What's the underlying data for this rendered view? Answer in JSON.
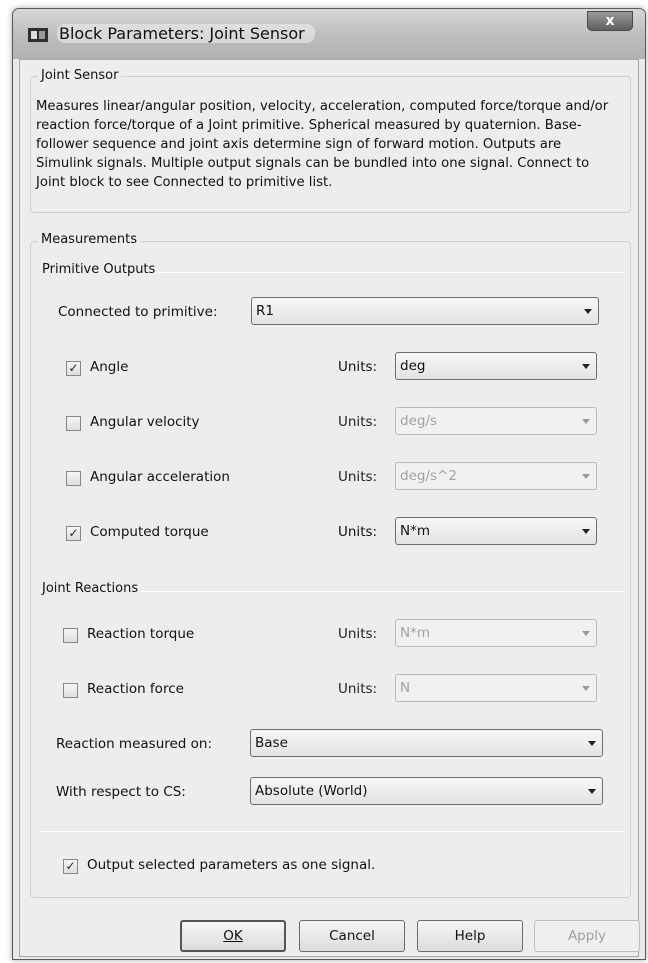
{
  "window": {
    "title": "Block Parameters: Joint Sensor",
    "close_label": "x"
  },
  "header_group": {
    "label": "Joint Sensor",
    "description": "Measures linear/angular position, velocity, acceleration, computed force/torque and/or reaction force/torque of a Joint primitive. Spherical measured by quaternion. Base-follower sequence and joint axis determine sign of forward motion. Outputs are Simulink signals. Multiple output signals can be bundled into one signal. Connect to Joint block to see Connected to primitive list."
  },
  "measurements": {
    "label": "Measurements",
    "primitive_outputs": {
      "label": "Primitive Outputs",
      "connected_label": "Connected to primitive:",
      "connected_value": "R1",
      "rows": [
        {
          "label": "Angle",
          "checked": "✓",
          "units_label": "Units:",
          "units_value": "deg"
        },
        {
          "label": "Angular velocity",
          "checked": "",
          "units_label": "Units:",
          "units_value": "deg/s"
        },
        {
          "label": "Angular acceleration",
          "checked": "",
          "units_label": "Units:",
          "units_value": "deg/s^2"
        },
        {
          "label": "Computed torque",
          "checked": "✓",
          "units_label": "Units:",
          "units_value": "N*m"
        }
      ]
    },
    "joint_reactions": {
      "label": "Joint Reactions",
      "rows": [
        {
          "label": "Reaction torque",
          "checked": "",
          "units_label": "Units:",
          "units_value": "N*m"
        },
        {
          "label": "Reaction force",
          "checked": "",
          "units_label": "Units:",
          "units_value": "N"
        }
      ],
      "measured_on_label": "Reaction measured on:",
      "measured_on_value": "Base",
      "respect_label": "With respect to CS:",
      "respect_value": "Absolute (World)"
    },
    "output_one_signal": {
      "checked": "✓",
      "label": "Output selected parameters as one signal."
    }
  },
  "buttons": {
    "ok": "OK",
    "cancel": "Cancel",
    "help": "Help",
    "apply": "Apply"
  }
}
